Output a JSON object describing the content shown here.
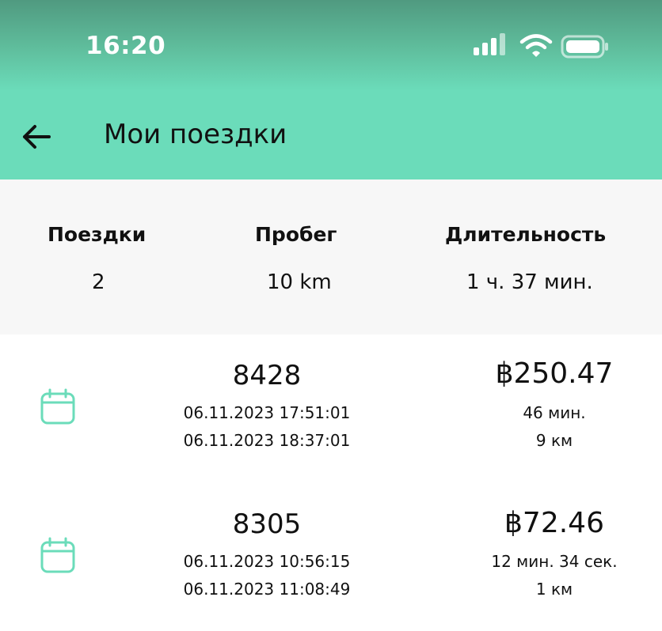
{
  "status_bar": {
    "time": "16:20"
  },
  "header": {
    "title": "Мои поездки",
    "back_icon": "arrow-left-icon"
  },
  "summary": {
    "trips_label": "Поездки",
    "trips_value": "2",
    "distance_label": "Пробег",
    "distance_value": "10 km",
    "duration_label": "Длительность",
    "duration_value": "1 ч. 37 мин."
  },
  "trips": [
    {
      "id": "8428",
      "start": "06.11.2023 17:51:01",
      "end": "06.11.2023 18:37:01",
      "price": "฿250.47",
      "duration": "46 мин.",
      "distance": "9 км"
    },
    {
      "id": "8305",
      "start": "06.11.2023 10:56:15",
      "end": "06.11.2023 11:08:49",
      "price": "฿72.46",
      "duration": "12 мин. 34 сек.",
      "distance": "1 км"
    }
  ],
  "colors": {
    "accent": "#6bdcba",
    "icon": "#6bdcba"
  }
}
